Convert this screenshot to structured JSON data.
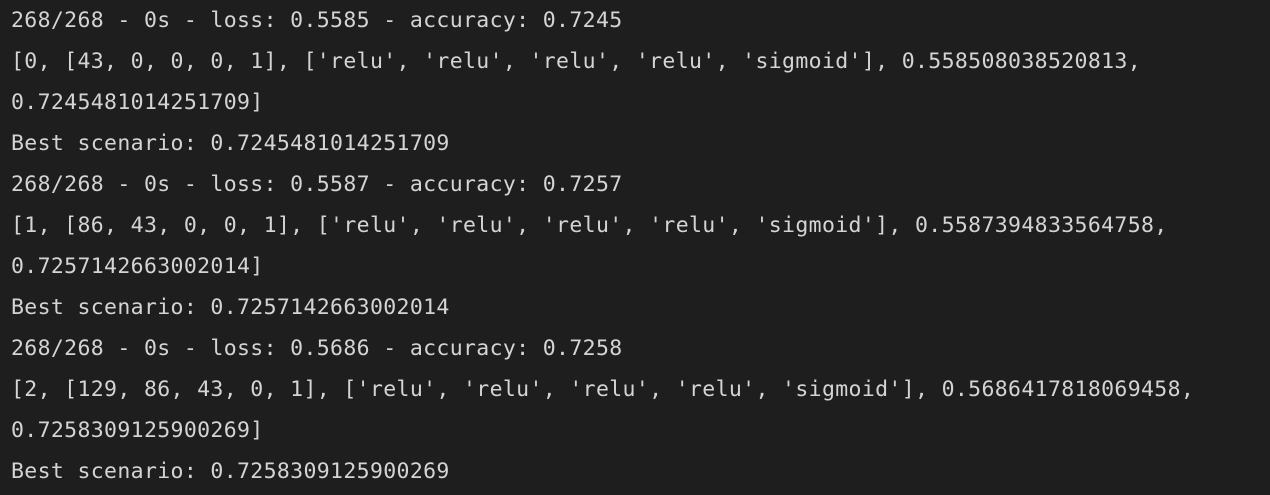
{
  "background_color": "#1e1e1e",
  "text_color": "#d4d4d4",
  "console": {
    "lines": [
      "268/268 - 0s - loss: 0.5585 - accuracy: 0.7245",
      "[0, [43, 0, 0, 0, 1], ['relu', 'relu', 'relu', 'relu', 'sigmoid'], 0.558508038520813,",
      "0.7245481014251709]",
      "Best scenario: 0.7245481014251709",
      "268/268 - 0s - loss: 0.5587 - accuracy: 0.7257",
      "[1, [86, 43, 0, 0, 1], ['relu', 'relu', 'relu', 'relu', 'sigmoid'], 0.5587394833564758,",
      "0.7257142663002014]",
      "Best scenario: 0.7257142663002014",
      "268/268 - 0s - loss: 0.5686 - accuracy: 0.7258",
      "[2, [129, 86, 43, 0, 1], ['relu', 'relu', 'relu', 'relu', 'sigmoid'], 0.5686417818069458,",
      "0.7258309125900269]",
      "Best scenario: 0.7258309125900269"
    ]
  }
}
